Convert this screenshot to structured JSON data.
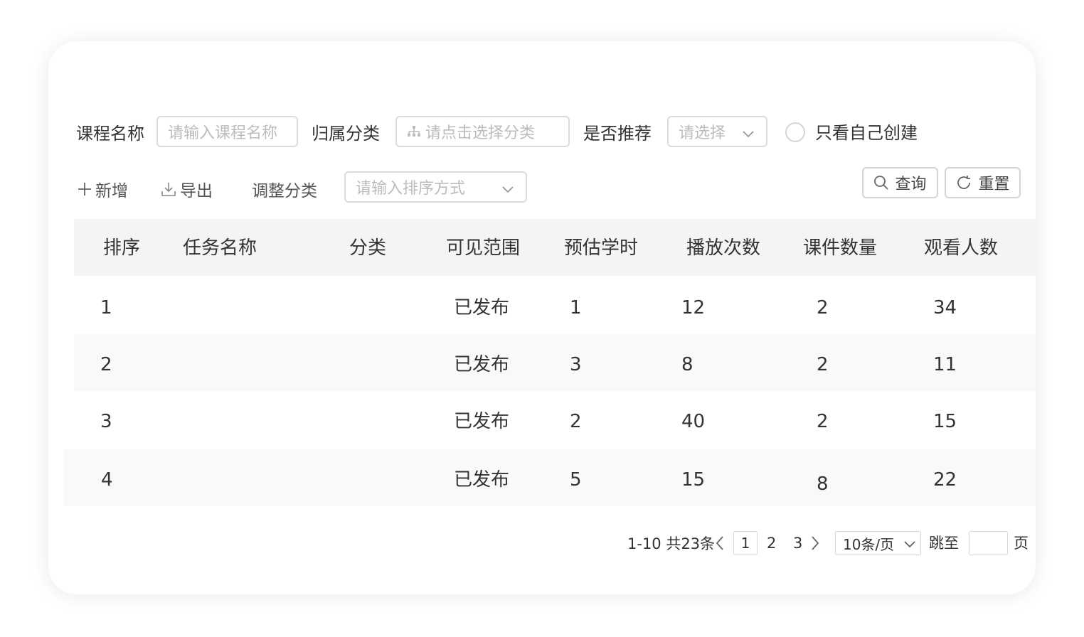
{
  "filters": {
    "course_name_label": "课程名称",
    "course_name_placeholder": "请输入课程名称",
    "category_label": "归属分类",
    "category_placeholder": "请点击选择分类",
    "recommend_label": "是否推荐",
    "recommend_placeholder": "请选择",
    "own_only_label": "只看自己创建"
  },
  "toolbar": {
    "add_label": "新增",
    "export_label": "导出",
    "adjust_label": "调整分类",
    "sort_placeholder": "请输入排序方式",
    "query_label": "查询",
    "reset_label": "重置"
  },
  "table": {
    "columns": [
      "排序",
      "任务名称",
      "分类",
      "可见范围",
      "预估学时",
      "播放次数",
      "课件数量",
      "观看人数"
    ],
    "rows": [
      {
        "order": "1",
        "name": "",
        "category": "",
        "visibility": "已发布",
        "hours": "1",
        "plays": "12",
        "courseware": "2",
        "viewers": "34"
      },
      {
        "order": "2",
        "name": "",
        "category": "",
        "visibility": "已发布",
        "hours": "3",
        "plays": "8",
        "courseware": "2",
        "viewers": "11"
      },
      {
        "order": "3",
        "name": "",
        "category": "",
        "visibility": "已发布",
        "hours": "2",
        "plays": "40",
        "courseware": "2",
        "viewers": "15"
      },
      {
        "order": "4",
        "name": "",
        "category": "",
        "visibility": "已发布",
        "hours": "5",
        "plays": "15",
        "courseware": "8",
        "viewers": "22"
      }
    ]
  },
  "pagination": {
    "summary": "1-10 共23条",
    "pages": [
      "1",
      "2",
      "3"
    ],
    "current_page": "1",
    "page_size": "10条/页",
    "jump_label": "跳至",
    "page_unit": "页"
  },
  "colors": {
    "header_bg": "#f3f5f2",
    "row_alt_bg": "#f9f9f9",
    "border": "#dcdcdc",
    "placeholder": "#bcbcbc"
  }
}
